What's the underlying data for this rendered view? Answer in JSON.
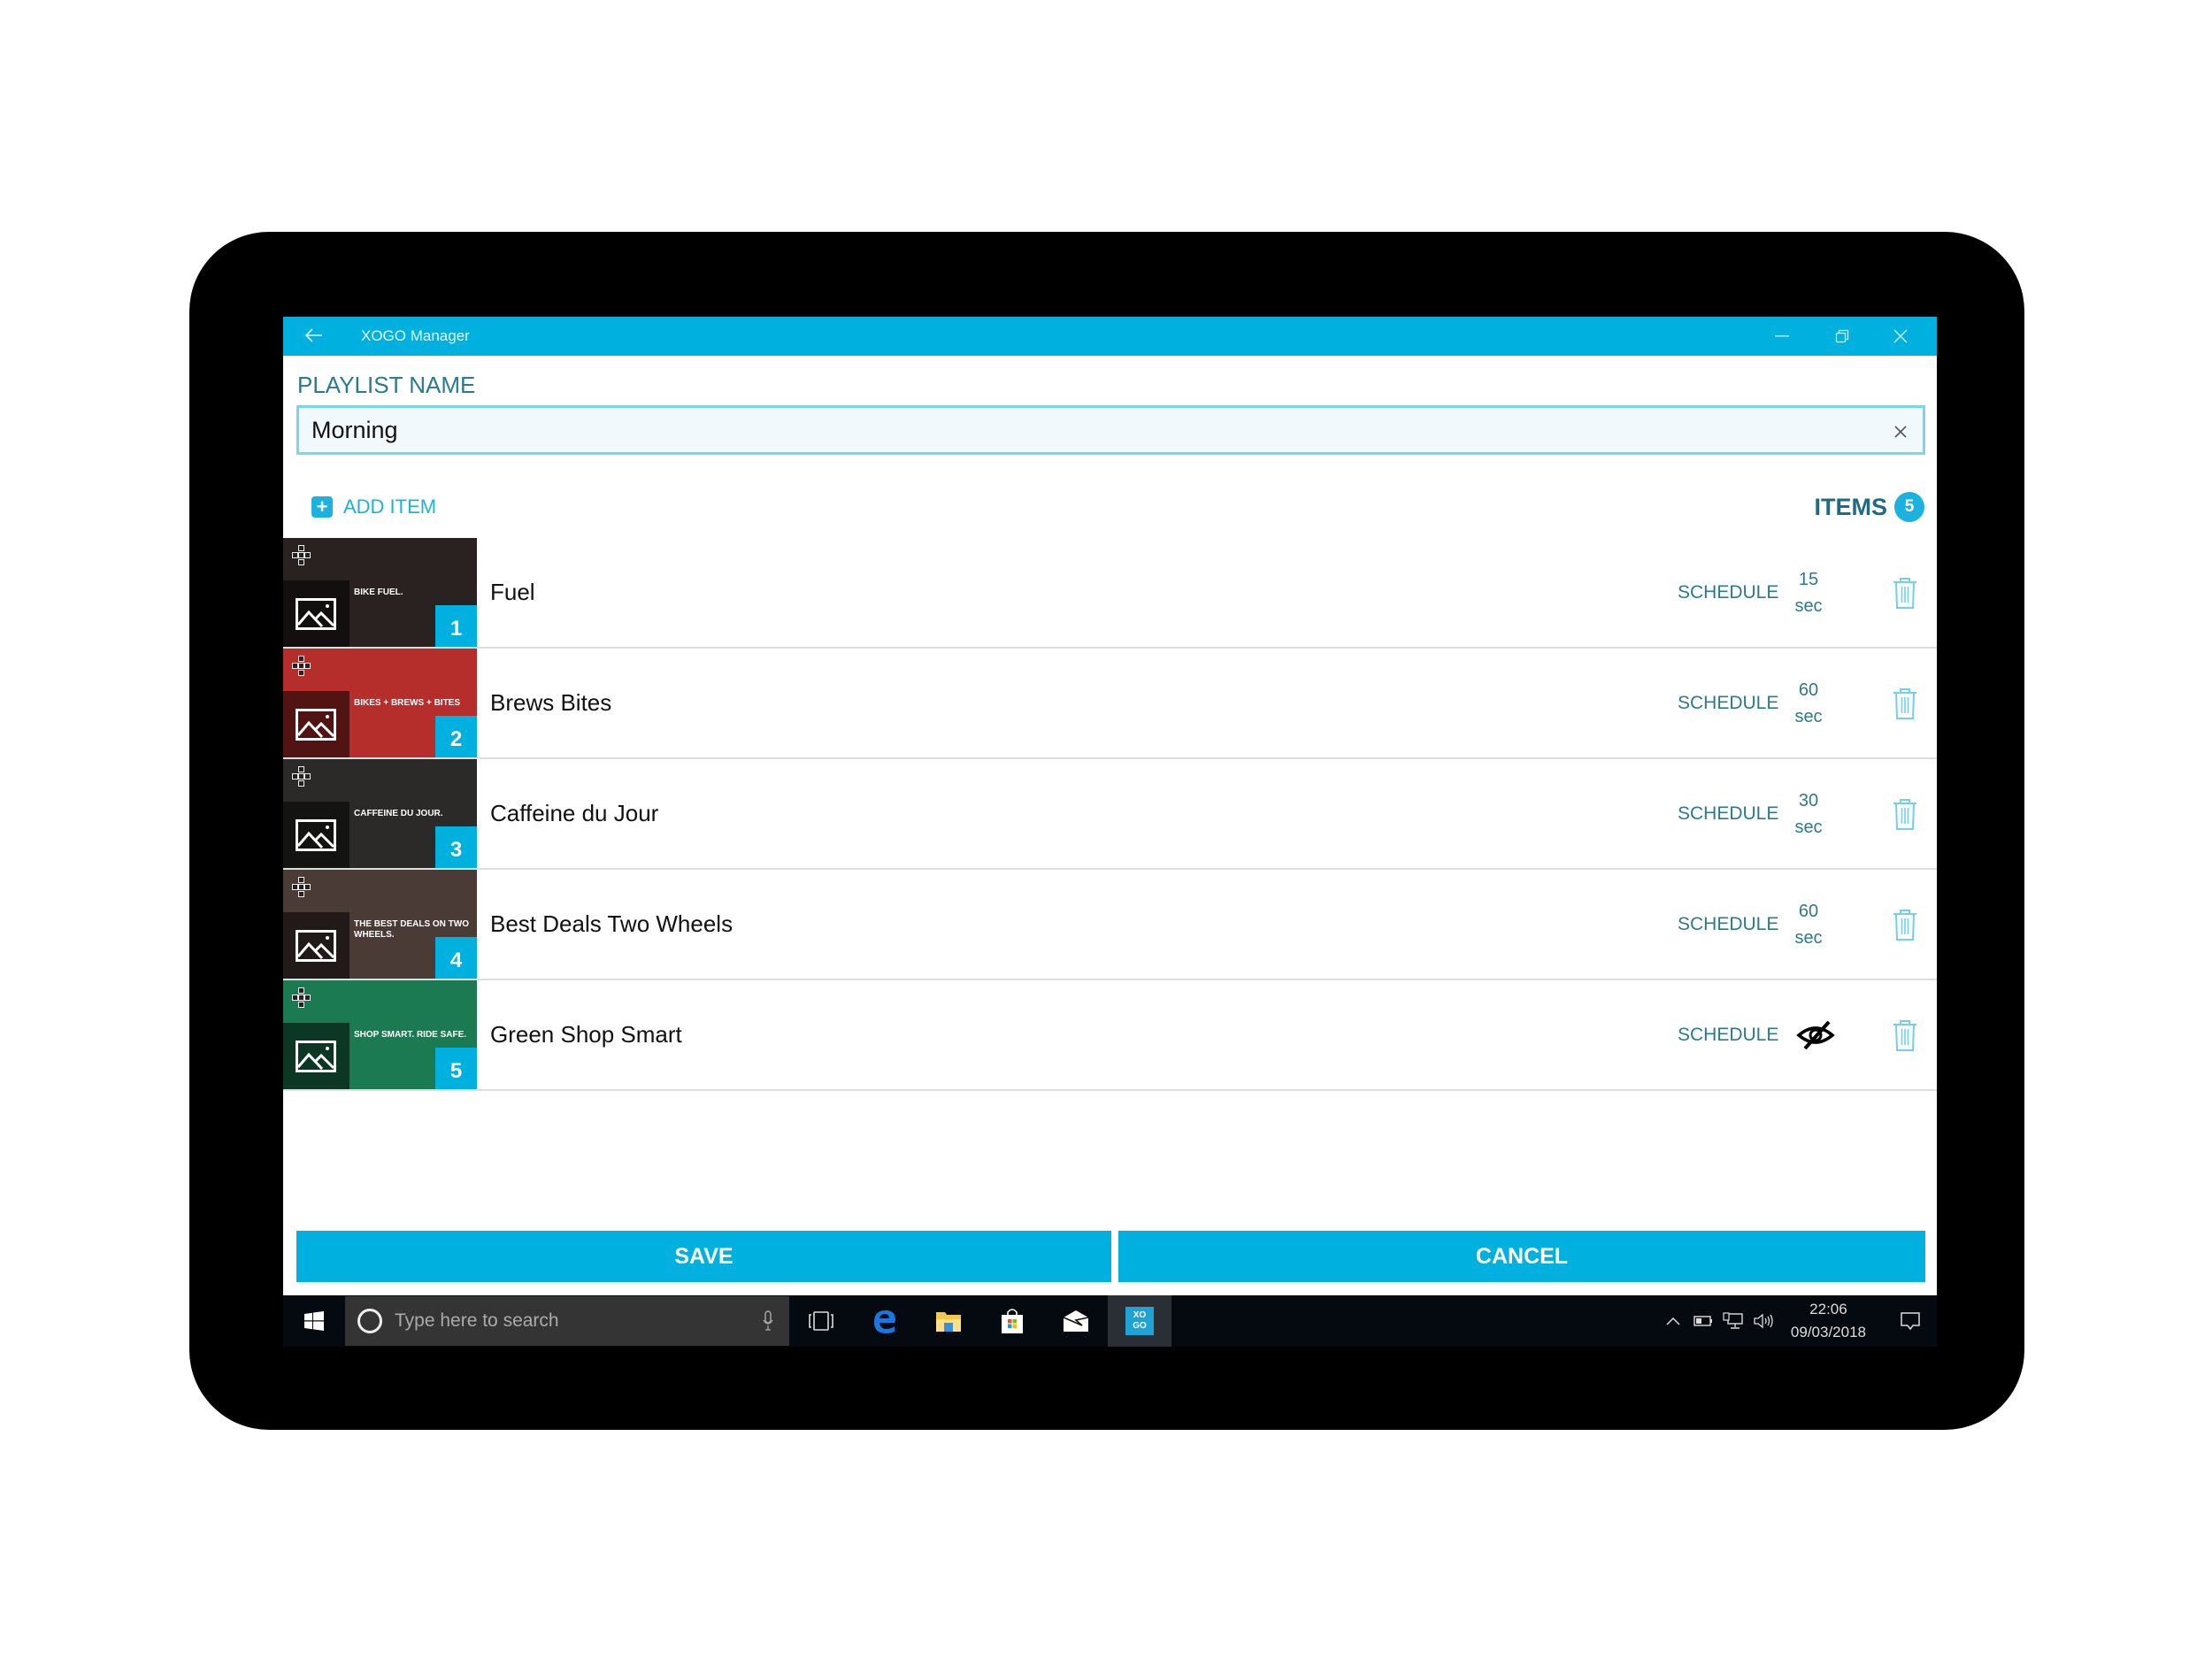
{
  "window": {
    "title": "XOGO Manager",
    "back_icon": "back-arrow-icon",
    "controls": [
      "minimize-icon",
      "restore-icon",
      "close-icon"
    ]
  },
  "playlist": {
    "label": "PLAYLIST NAME",
    "name_value": "Morning",
    "clear_icon": "clear-x-icon"
  },
  "toolbar": {
    "add_item_label": "ADD ITEM",
    "items_label": "ITEMS",
    "items_count": "5"
  },
  "items": [
    {
      "number": "1",
      "name": "Fuel",
      "schedule_label": "SCHEDULE",
      "duration_value": "15",
      "duration_unit": "sec",
      "hidden": false,
      "thumb_caption": "BIKE FUEL.",
      "thumb_color": "#2a2220"
    },
    {
      "number": "2",
      "name": "Brews Bites",
      "schedule_label": "SCHEDULE",
      "duration_value": "60",
      "duration_unit": "sec",
      "hidden": false,
      "thumb_caption": "BIKES + BREWS + BITES",
      "thumb_color": "#b52e2c"
    },
    {
      "number": "3",
      "name": "Caffeine du Jour",
      "schedule_label": "SCHEDULE",
      "duration_value": "30",
      "duration_unit": "sec",
      "hidden": false,
      "thumb_caption": "CAFFEINE DU JOUR.",
      "thumb_color": "#2b2a28"
    },
    {
      "number": "4",
      "name": "Best Deals Two Wheels",
      "schedule_label": "SCHEDULE",
      "duration_value": "60",
      "duration_unit": "sec",
      "hidden": false,
      "thumb_caption": "THE BEST DEALS ON TWO WHEELS.",
      "thumb_color": "#4a3b36"
    },
    {
      "number": "5",
      "name": "Green Shop Smart",
      "schedule_label": "SCHEDULE",
      "duration_value": null,
      "duration_unit": null,
      "hidden": true,
      "thumb_caption": "SHOP SMART. RIDE SAFE.",
      "thumb_color": "#1b7a52"
    }
  ],
  "actions": {
    "save_label": "SAVE",
    "cancel_label": "CANCEL"
  },
  "taskbar": {
    "search_placeholder": "Type here to search",
    "apps": [
      "task-view-icon",
      "edge-icon",
      "file-explorer-icon",
      "store-icon",
      "mail-icon",
      "xogo-app-icon"
    ],
    "xogo_label_top": "XO",
    "xogo_label_bottom": "GO",
    "time": "22:06",
    "date": "09/03/2018"
  },
  "colors": {
    "accent": "#00b0df",
    "label_teal": "#2b7a90",
    "input_border": "#79d5f2"
  }
}
